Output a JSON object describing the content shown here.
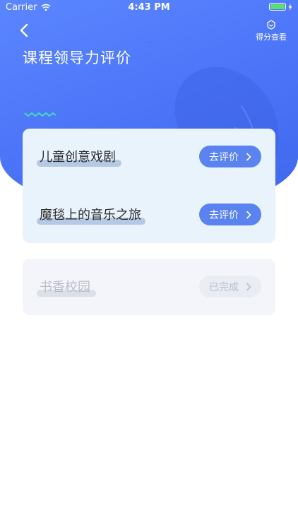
{
  "status_bar": {
    "carrier": "Carrier",
    "time": "4:43 PM"
  },
  "header": {
    "title": "课程领导力评价",
    "score_link_label": "得分查看"
  },
  "courses": [
    {
      "name": "儿童创意戏剧",
      "action_label": "去评价",
      "completed": false
    },
    {
      "name": "魔毯上的音乐之旅",
      "action_label": "去评价",
      "completed": false
    },
    {
      "name": "书香校园",
      "action_label": "已完成",
      "completed": true
    }
  ],
  "colors": {
    "header_bg": "#4a73f7",
    "action_button": "#5b83f0",
    "active_card_bg": "#e9f3fc",
    "done_card_bg": "#f3f5fa",
    "wave_accent": "#3fe0b8"
  },
  "icons": {
    "back": "chevron-left-icon",
    "score": "badge-icon",
    "action_arrow": "chevron-right-icon",
    "wifi": "wifi-icon",
    "battery": "battery-icon"
  }
}
